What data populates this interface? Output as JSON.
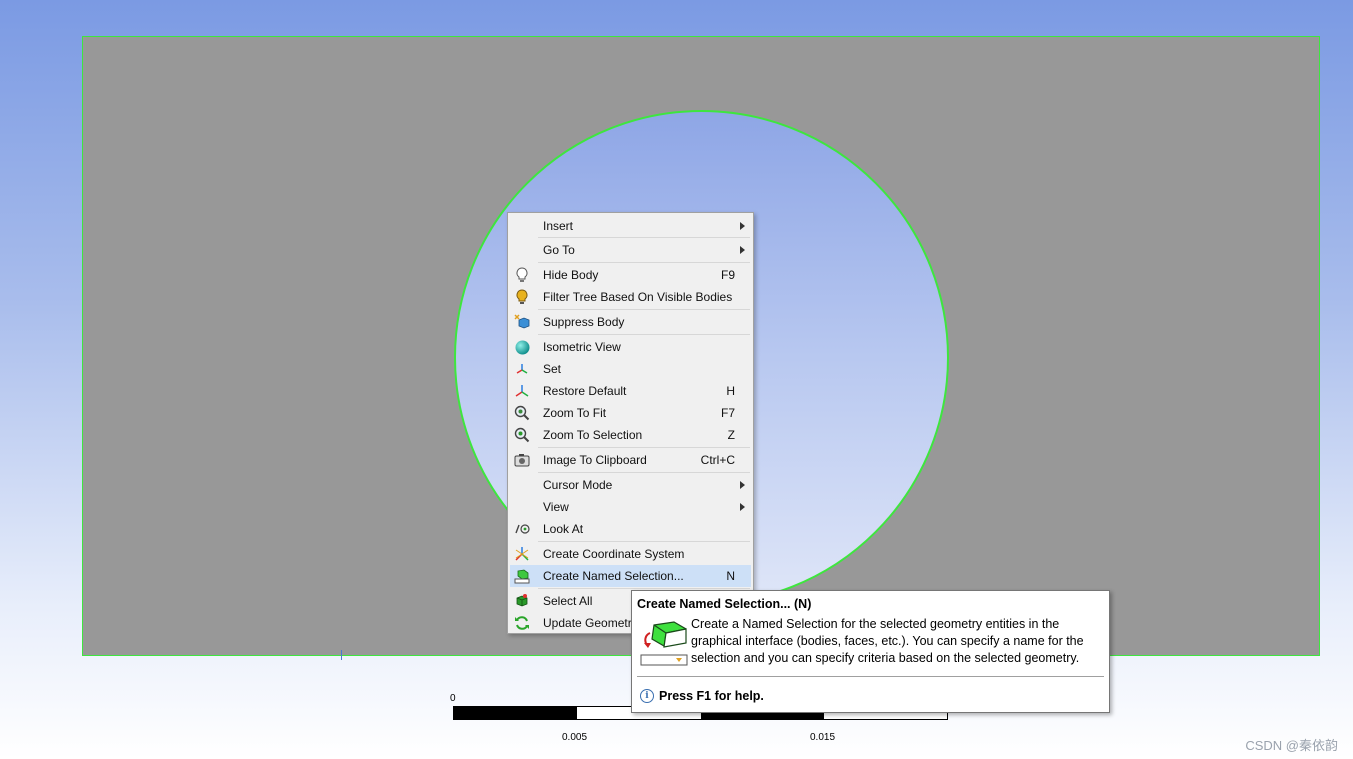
{
  "scale": {
    "zero": "0",
    "mid_label": "0.005",
    "right_label": "0.015"
  },
  "watermark": "CSDN @秦依韵",
  "menu": {
    "items": [
      {
        "label": "Insert",
        "submenu": true,
        "icon": ""
      },
      {
        "label": "Go To",
        "submenu": true,
        "icon": ""
      },
      {
        "label": "Hide Body",
        "shortcut": "F9",
        "icon": "lightbulb-icon"
      },
      {
        "label": "Filter Tree Based On Visible Bodies",
        "icon": "lightbulb-filled-icon"
      },
      {
        "label": "Suppress Body",
        "icon": "suppress-body-icon"
      },
      {
        "label": "Isometric View",
        "icon": "sphere-icon"
      },
      {
        "label": "Set",
        "icon": "axis-set-icon"
      },
      {
        "label": "Restore Default",
        "shortcut": "H",
        "icon": "axis-restore-icon"
      },
      {
        "label": "Zoom To Fit",
        "shortcut": "F7",
        "icon": "zoom-fit-icon"
      },
      {
        "label": "Zoom To Selection",
        "shortcut": "Z",
        "icon": "zoom-selection-icon"
      },
      {
        "label": "Image To Clipboard",
        "shortcut": "Ctrl+C",
        "icon": "camera-icon"
      },
      {
        "label": "Cursor Mode",
        "submenu": true,
        "icon": ""
      },
      {
        "label": "View",
        "submenu": true,
        "icon": ""
      },
      {
        "label": "Look At",
        "icon": "look-at-icon"
      },
      {
        "label": "Create Coordinate System",
        "icon": "coordinate-system-icon"
      },
      {
        "label": "Create Named Selection...",
        "shortcut": "N",
        "icon": "named-selection-icon",
        "highlighted": true
      },
      {
        "label": "Select All",
        "icon": "select-all-icon"
      },
      {
        "label": "Update Geometry",
        "icon": "refresh-icon"
      }
    ]
  },
  "tooltip": {
    "title": "Create Named Selection... (N)",
    "body": "Create a Named Selection for the selected geometry entities in the graphical interface (bodies, faces, etc.). You can specify a name for the selection and you can specify criteria based on the selected geometry.",
    "help": "Press F1 for help."
  },
  "colors": {
    "geometry": "#989898",
    "edge": "#3ee63e",
    "highlight": "#cde0f7"
  }
}
